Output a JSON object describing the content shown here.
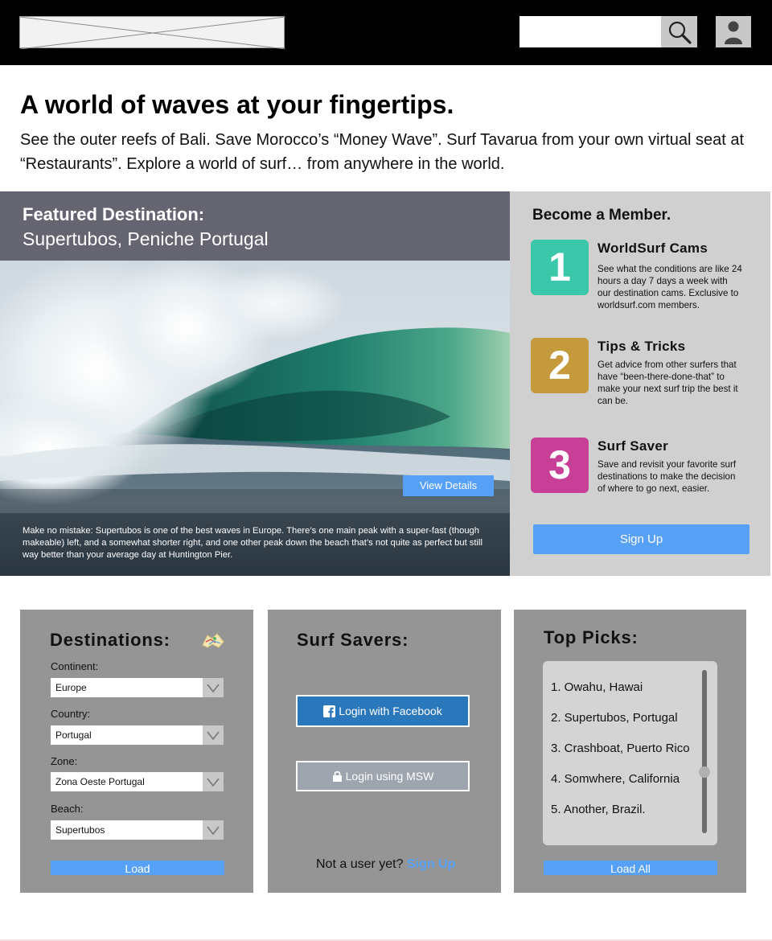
{
  "header": {
    "search": {
      "value": "",
      "placeholder": ""
    }
  },
  "hero": {
    "title": "A world of waves at your fingertips.",
    "text": "See the outer reefs of Bali. Save Morocco’s “Money Wave”. Surf Tavarua from your own virtual seat at “Restaurants”. Explore a world of surf… from anywhere in the world."
  },
  "featured": {
    "label": "Featured Destination:",
    "place": "Supertubos, Peniche Portugal",
    "view_details": "View Details",
    "description": "Make no mistake: Supertubos is one of the best waves in Europe. There’s one main peak with a super-fast (though makeable) left, and a somewhat shorter right, and one other peak down the beach that’s not quite as perfect but still way better than your average day at Huntington Pier."
  },
  "membership": {
    "title": "Become a Member.",
    "perks": [
      {
        "number": "1",
        "title": "WorldSurf Cams",
        "description": "See what the conditions are like 24 hours a day 7 days a week with our destination cams. Exclusive to worldsurf.com members.",
        "color": "#3bc7a9"
      },
      {
        "number": "2",
        "title": "Tips & Tricks",
        "description": "Get advice from other surfers that have “been-there-done-that” to make your next surf trip the best it can be.",
        "color": "#c49a3c"
      },
      {
        "number": "3",
        "title": "Surf Saver",
        "description": "Save and revisit your favorite surf destinations to make the decision of where to go next, easier.",
        "color": "#c83f98"
      }
    ],
    "signup": "Sign Up"
  },
  "destinations": {
    "title": "Destinations:",
    "icon": "map-icon",
    "continent": {
      "label": "Continent:",
      "value": "Europe"
    },
    "country": {
      "label": "Country:",
      "value": "Portugal"
    },
    "zone": {
      "label": "Zone:",
      "value": "Zona Oeste Portugal"
    },
    "beach": {
      "label": "Beach:",
      "value": "Supertubos"
    },
    "load": "Load"
  },
  "savers": {
    "title": "Surf Savers:",
    "facebook": "Login with Facebook",
    "msw": "Login using MSW",
    "not_user": "Not a user yet?",
    "signup_link": "Sign Up"
  },
  "top_picks": {
    "title": "Top Picks:",
    "items": [
      "1. Owahu, Hawai",
      "2. Supertubos, Portugal",
      "3. Crashboat, Puerto Rico",
      "4. Somwhere, California",
      "5. Another, Brazil."
    ],
    "load_all": "Load All"
  },
  "colors": {
    "accent": "#56a0f5",
    "facebook": "#2a77bb",
    "panel": "#959595"
  }
}
